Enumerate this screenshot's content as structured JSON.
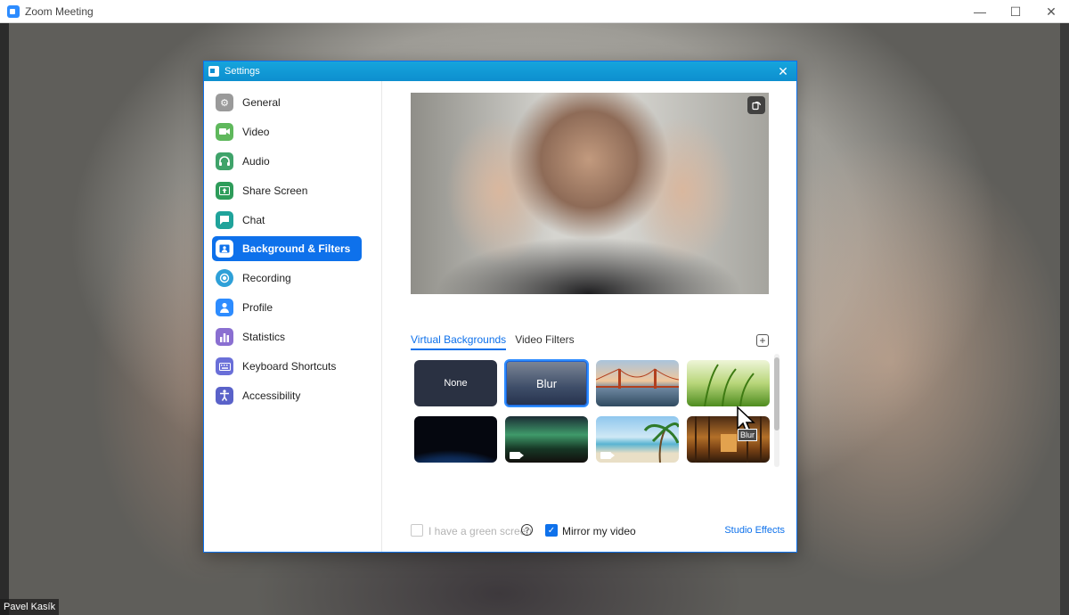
{
  "window": {
    "title": "Zoom Meeting",
    "controls": {
      "minimize": "—",
      "maximize": "☐",
      "close": "✕"
    }
  },
  "meeting": {
    "participant_name": "Pavel Kasík"
  },
  "settings": {
    "title": "Settings",
    "close": "✕",
    "nav": [
      {
        "label": "General",
        "icon": "gear-icon",
        "color": "#9a9a9a"
      },
      {
        "label": "Video",
        "icon": "video-camera-icon",
        "color": "#5fb85c"
      },
      {
        "label": "Audio",
        "icon": "headphones-icon",
        "color": "#3fa36a"
      },
      {
        "label": "Share Screen",
        "icon": "share-screen-icon",
        "color": "#2e9c5a"
      },
      {
        "label": "Chat",
        "icon": "chat-icon",
        "color": "#1fa39b"
      },
      {
        "label": "Background & Filters",
        "icon": "person-icon",
        "color": "#0e71eb"
      },
      {
        "label": "Recording",
        "icon": "record-icon",
        "color": "#2ea0d8"
      },
      {
        "label": "Profile",
        "icon": "profile-icon",
        "color": "#2d8cff"
      },
      {
        "label": "Statistics",
        "icon": "statistics-icon",
        "color": "#8a6fd1"
      },
      {
        "label": "Keyboard Shortcuts",
        "icon": "keyboard-icon",
        "color": "#6a6fd8"
      },
      {
        "label": "Accessibility",
        "icon": "accessibility-icon",
        "color": "#5a62c9"
      }
    ],
    "active_nav": "Background & Filters",
    "tabs": {
      "virtual": "Virtual Backgrounds",
      "filters": "Video Filters"
    },
    "backgrounds": {
      "none": "None",
      "blur": "Blur",
      "images": [
        "golden-gate-bridge",
        "green-grass",
        "earth-from-space",
        "northern-lights",
        "beach-palm",
        "library"
      ]
    },
    "tooltip": "Blur",
    "footer": {
      "green_screen": "I have a green screen",
      "help": "?",
      "mirror": "Mirror my video",
      "mirror_checked": true,
      "green_checked": false,
      "studio_effects": "Studio Effects"
    }
  }
}
